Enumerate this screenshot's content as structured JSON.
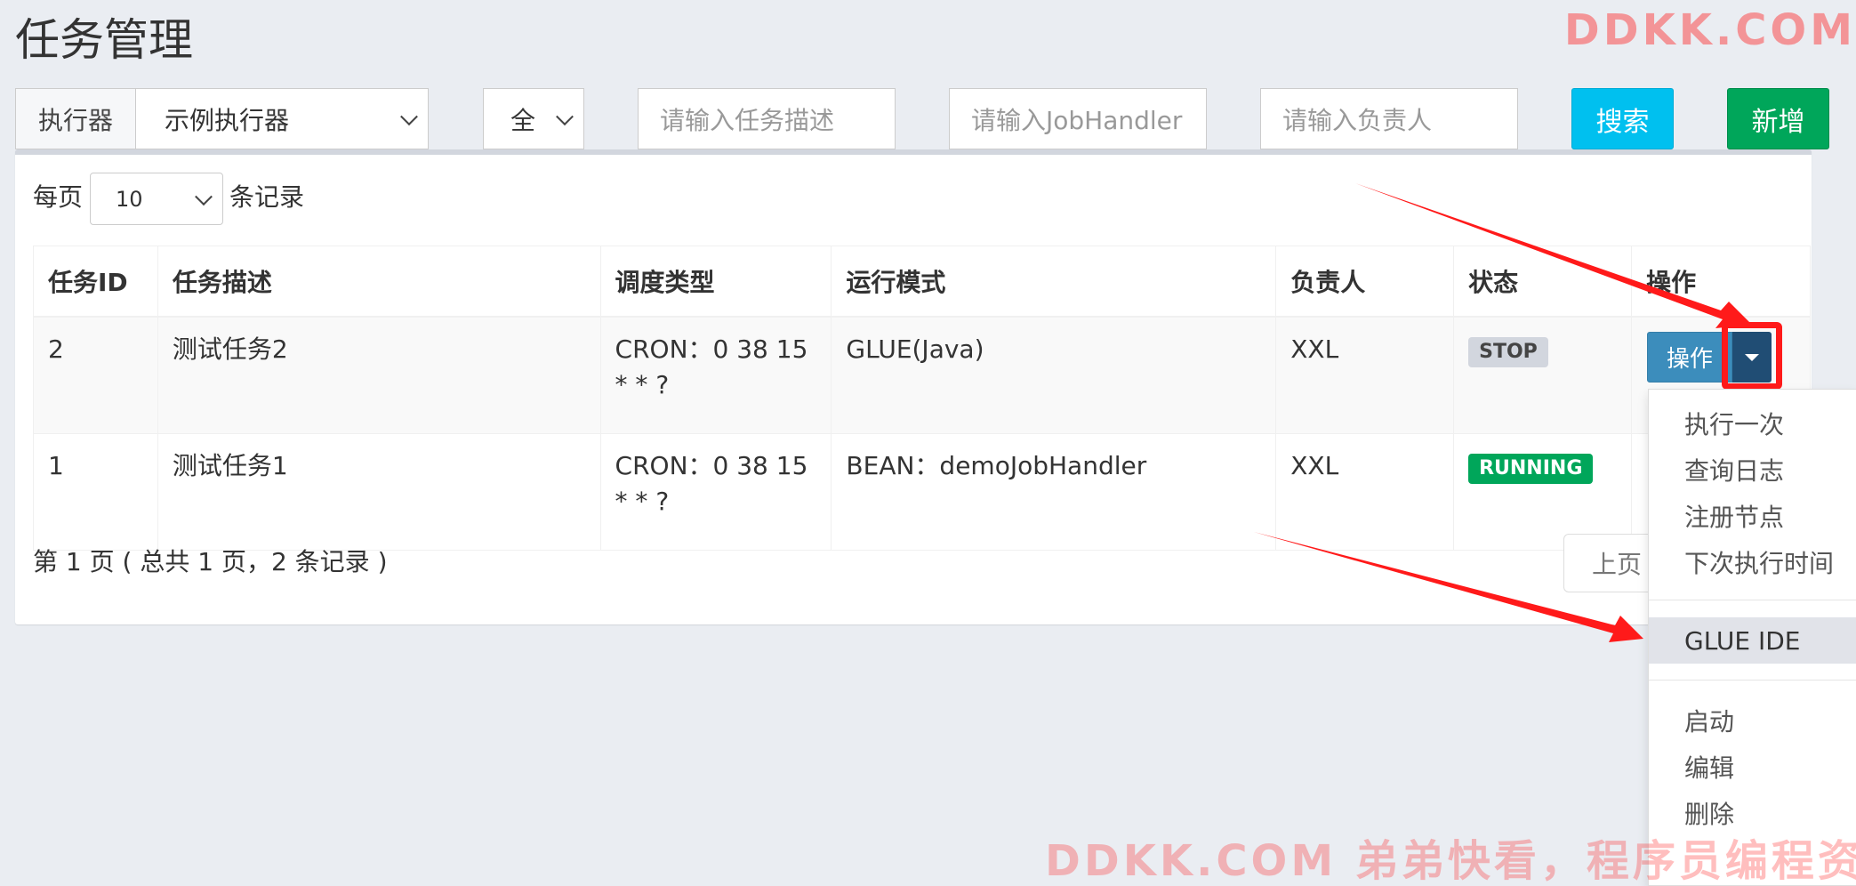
{
  "page": {
    "title": "任务管理"
  },
  "watermark": {
    "top": "DDKK.COM",
    "bottom": "DDKK.COM 弟弟快看，程序员编程资料站"
  },
  "filters": {
    "executor_label": "执行器",
    "executor_value": "示例执行器",
    "status_value": "全",
    "desc_placeholder": "请输入任务描述",
    "handler_placeholder": "请输入JobHandler",
    "author_placeholder": "请输入负责人",
    "search_label": "搜索",
    "add_label": "新增"
  },
  "paging": {
    "per_page_prefix": "每页",
    "per_page_value": "10",
    "per_page_suffix": "条记录",
    "info": "第 1 页 ( 总共 1 页，2 条记录 )",
    "prev_label": "上页"
  },
  "table": {
    "headers": [
      "任务ID",
      "任务描述",
      "调度类型",
      "运行模式",
      "负责人",
      "状态",
      "操作"
    ],
    "rows": [
      {
        "id": "2",
        "desc": "测试任务2",
        "schedule": "CRON：0 38 15 * * ?",
        "mode": "GLUE(Java)",
        "author": "XXL",
        "status": "STOP"
      },
      {
        "id": "1",
        "desc": "测试任务1",
        "schedule": "CRON：0 38 15 * * ?",
        "mode": "BEAN：demoJobHandler",
        "author": "XXL",
        "status": "RUNNING"
      }
    ],
    "op_label": "操作"
  },
  "dropdown": {
    "items": [
      "执行一次",
      "查询日志",
      "注册节点",
      "下次执行时间",
      "GLUE IDE",
      "启动",
      "编辑",
      "删除"
    ],
    "active_item": "GLUE IDE"
  },
  "colors": {
    "search_button": "#00c0ef",
    "add_button": "#00a65a",
    "op_button": "#3c8dbc",
    "running_badge": "#00a65a",
    "stop_badge": "#d2d6de",
    "annotation_arrow": "#ff1a1a"
  }
}
